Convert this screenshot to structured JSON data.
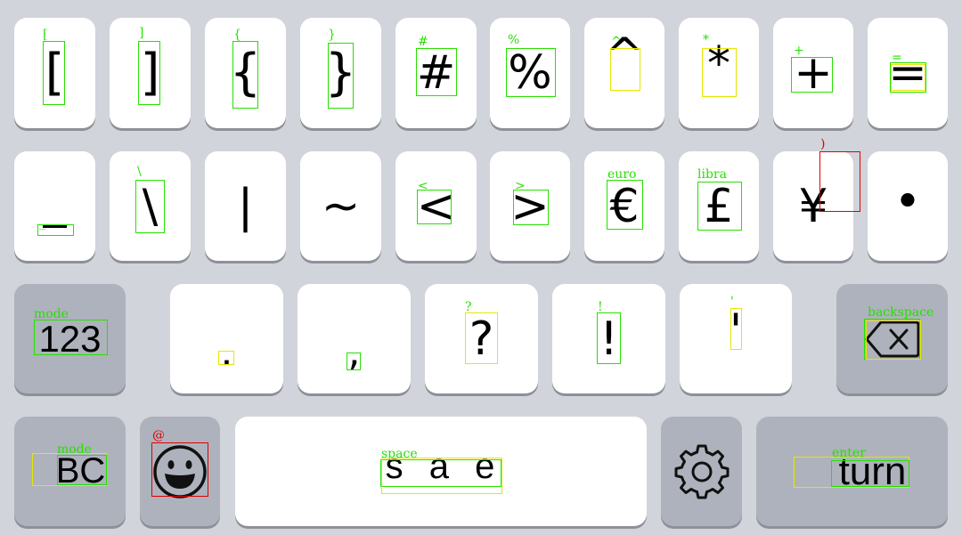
{
  "colors": {
    "background": "#d1d4da",
    "key": "#ffffff",
    "function_key": "#aeb2bc",
    "annotation_green": "#26e000",
    "annotation_yellow": "#e6e600",
    "annotation_red": "#e00000"
  },
  "row1": [
    {
      "tag": "[",
      "glyph": "["
    },
    {
      "tag": "]",
      "glyph": "]"
    },
    {
      "tag": "{",
      "glyph": "{"
    },
    {
      "tag": "}",
      "glyph": "}"
    },
    {
      "tag": "#",
      "glyph": "#"
    },
    {
      "tag": "%",
      "glyph": "%"
    },
    {
      "tag": "^",
      "glyph": "^"
    },
    {
      "tag": "*",
      "glyph": "*"
    },
    {
      "tag": "+",
      "glyph": "+"
    },
    {
      "tag": "=",
      "glyph": "="
    }
  ],
  "row2": [
    {
      "tag": "_",
      "glyph": "_"
    },
    {
      "tag": "\\",
      "glyph": "\\"
    },
    {
      "tag": "",
      "glyph": "|"
    },
    {
      "tag": "",
      "glyph": "~"
    },
    {
      "tag": "<",
      "glyph": "<"
    },
    {
      "tag": ">",
      "glyph": ">"
    },
    {
      "tag": "euro",
      "glyph": "€"
    },
    {
      "tag": "libra",
      "glyph": "£"
    },
    {
      "tag": ")",
      "glyph": "¥"
    },
    {
      "tag": "",
      "glyph": "•"
    }
  ],
  "row3": {
    "mode": {
      "tag": "mode",
      "label": "123"
    },
    "keys": [
      {
        "tag": "",
        "glyph": "."
      },
      {
        "tag": "",
        "glyph": ","
      },
      {
        "tag": "?",
        "glyph": "?"
      },
      {
        "tag": "!",
        "glyph": "!"
      },
      {
        "tag": "'",
        "glyph": "'"
      }
    ],
    "backspace": {
      "tag": "backspace",
      "icon": "backspace-icon"
    }
  },
  "row4": {
    "mode": {
      "tag": "mode",
      "label": "BC"
    },
    "emoji": {
      "tag": "@",
      "icon": "emoji-icon"
    },
    "space": {
      "tag": "space",
      "label": "s a e"
    },
    "settings": {
      "icon": "gear-icon"
    },
    "enter": {
      "tag": "enter",
      "label": "turn"
    }
  }
}
